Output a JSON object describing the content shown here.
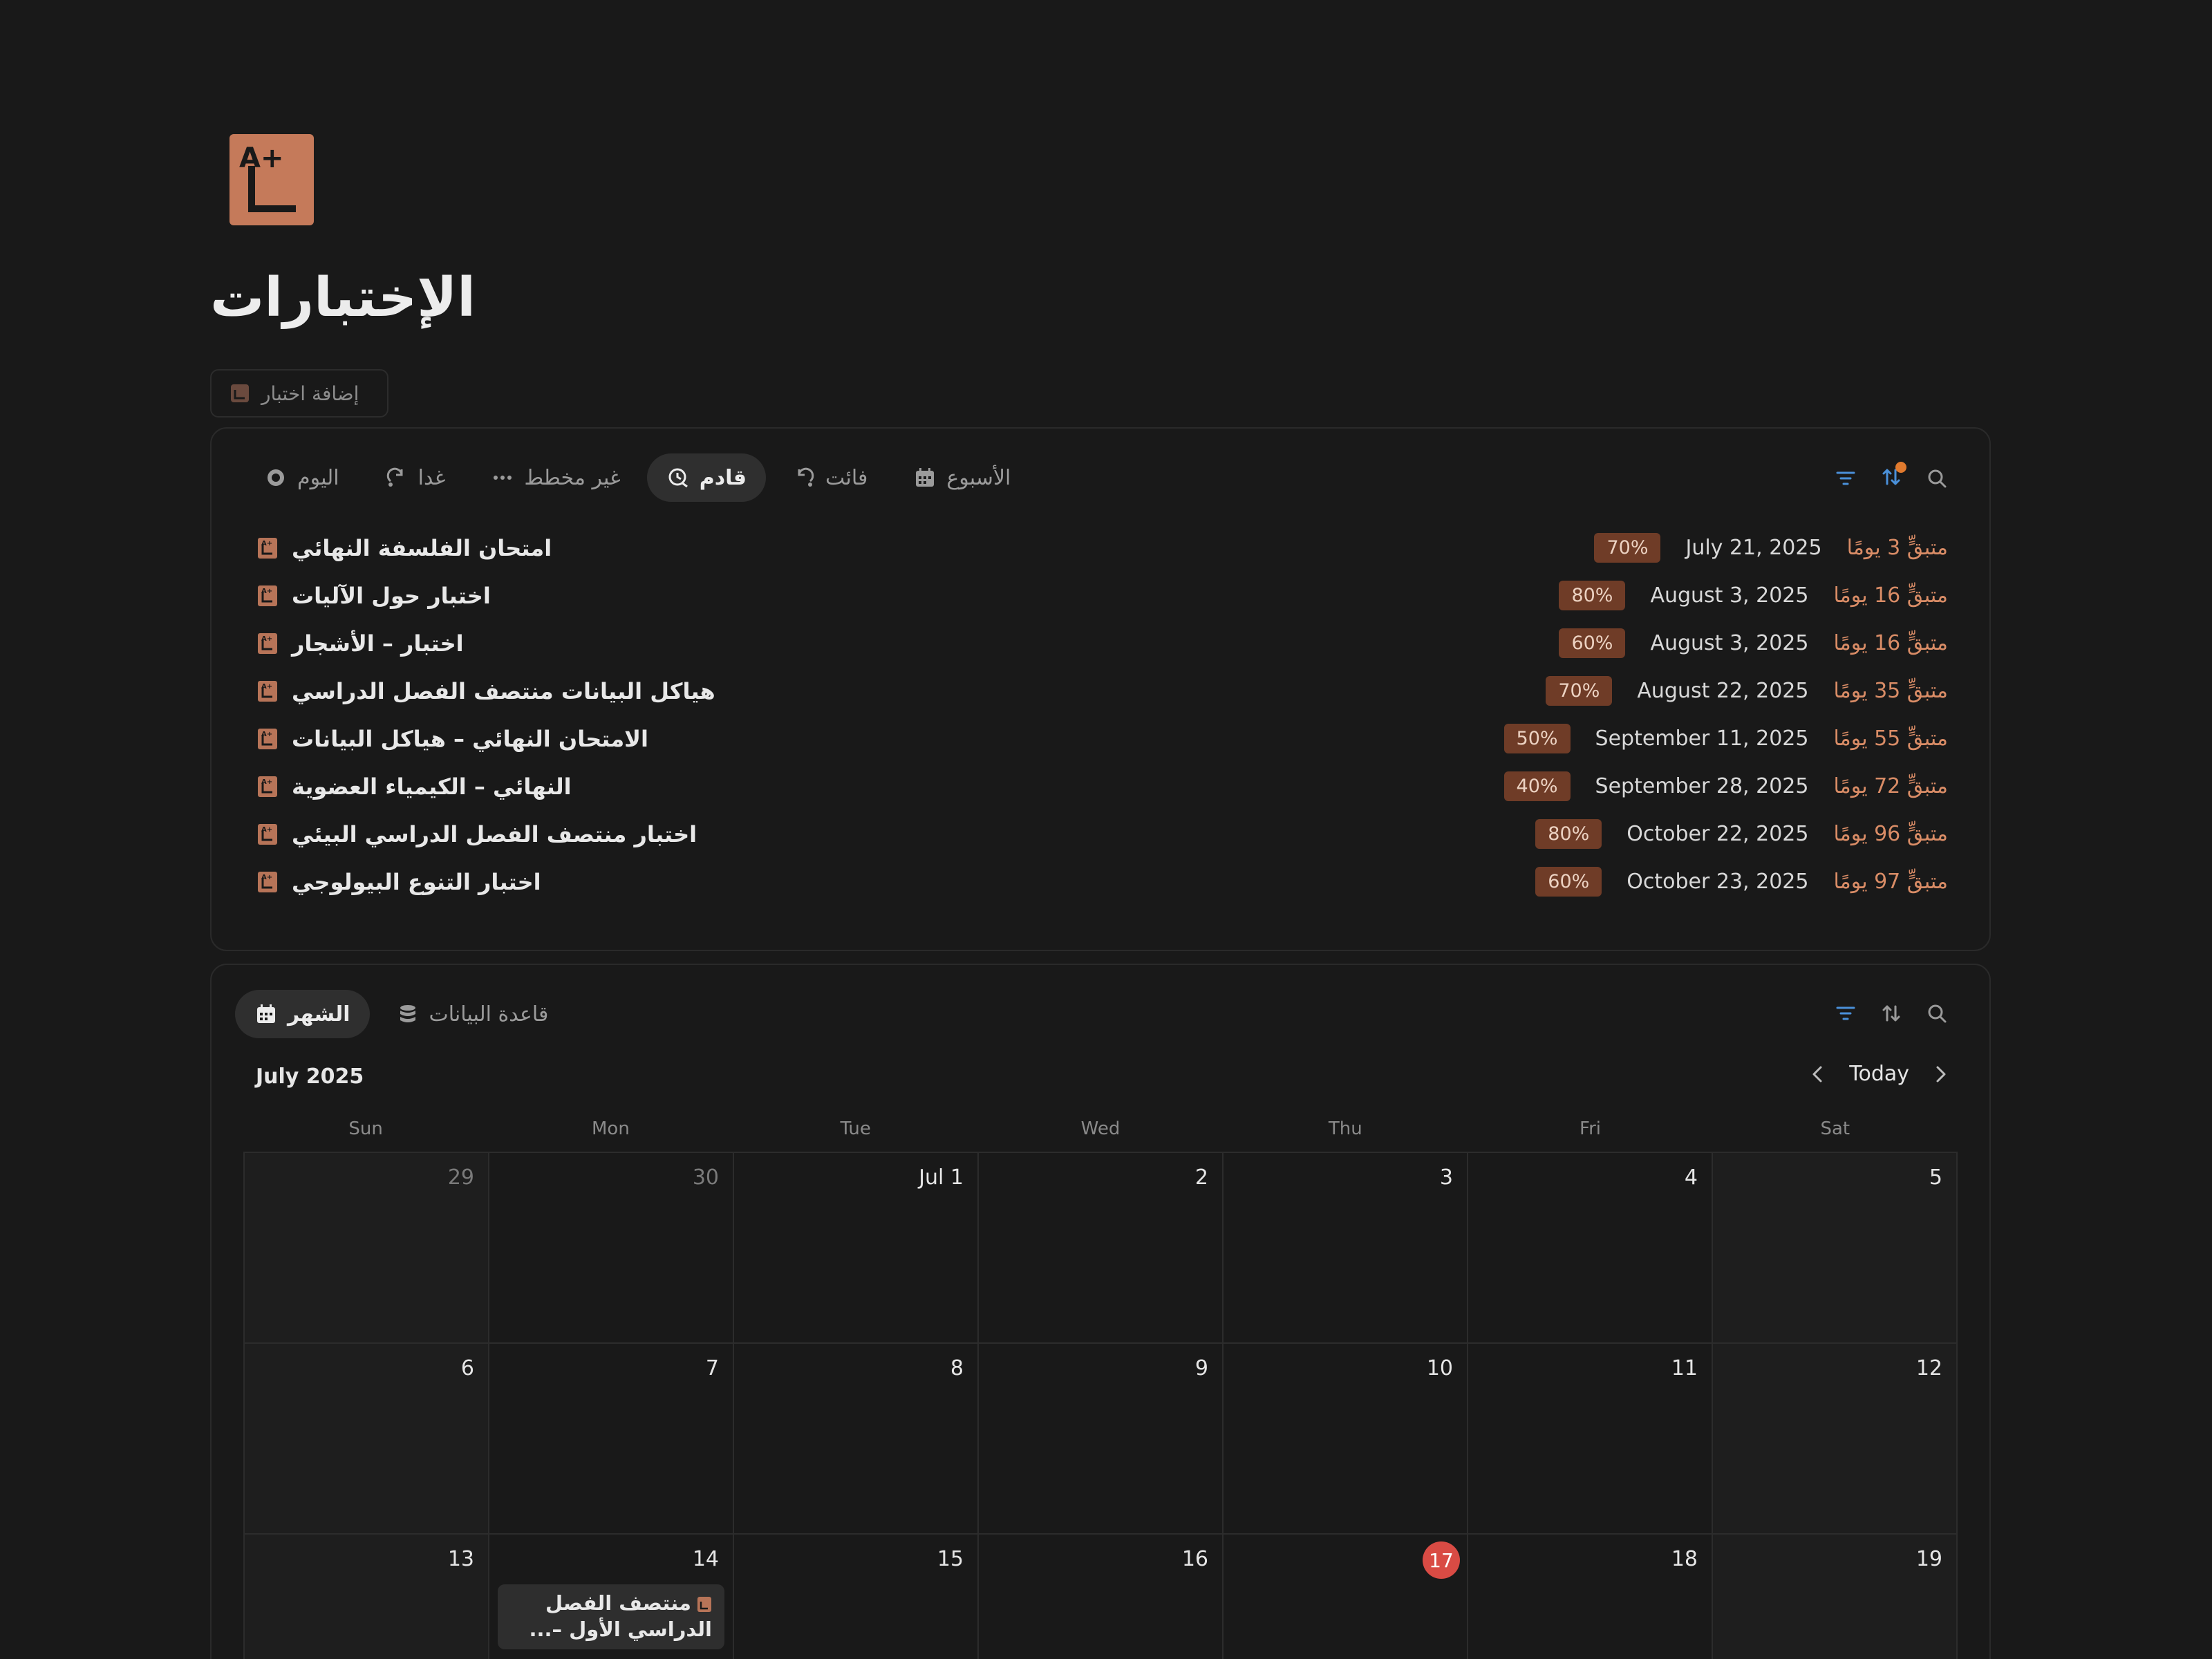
{
  "page": {
    "title": "الإختبارات",
    "add_button": "إضافة اختبار"
  },
  "upcoming": {
    "tabs": [
      {
        "label": "اليوم",
        "icon": "circle-icon",
        "active": false
      },
      {
        "label": "غدا",
        "icon": "redo-icon",
        "active": false
      },
      {
        "label": "غير مخطط",
        "icon": "dots-icon",
        "active": false
      },
      {
        "label": "قادم",
        "icon": "clock-arrow-icon",
        "active": true
      },
      {
        "label": "فائت",
        "icon": "undo-icon",
        "active": false
      },
      {
        "label": "الأسبوع",
        "icon": "calendar-icon",
        "active": false
      }
    ],
    "rows": [
      {
        "name": "امتحان الفلسفة النهائي",
        "pct": "70%",
        "date": "July 21, 2025",
        "remaining": "متبقٍّ 3 يومًا"
      },
      {
        "name": "اختبار حول الآليات",
        "pct": "80%",
        "date": "August 3, 2025",
        "remaining": "متبقٍّ 16 يومًا"
      },
      {
        "name": "اختبار – الأشجار",
        "pct": "60%",
        "date": "August 3, 2025",
        "remaining": "متبقٍّ 16 يومًا"
      },
      {
        "name": "هياكل البيانات منتصف الفصل الدراسي",
        "pct": "70%",
        "date": "August 22, 2025",
        "remaining": "متبقٍّ 35 يومًا"
      },
      {
        "name": "الامتحان النهائي – هياكل البيانات",
        "pct": "50%",
        "date": "September 11, 2025",
        "remaining": "متبقٍّ 55 يومًا"
      },
      {
        "name": "النهائي – الكيمياء العضوية",
        "pct": "40%",
        "date": "September 28, 2025",
        "remaining": "متبقٍّ 72 يومًا"
      },
      {
        "name": "اختبار منتصف الفصل الدراسي البيئي",
        "pct": "80%",
        "date": "October 22, 2025",
        "remaining": "متبقٍّ 96 يومًا"
      },
      {
        "name": "اختبار التنوع البيولوجي",
        "pct": "60%",
        "date": "October 23, 2025",
        "remaining": "متبقٍّ 97 يومًا"
      }
    ]
  },
  "calendar": {
    "tabs": [
      {
        "label": "الشهر",
        "icon": "calendar-icon",
        "active": true
      },
      {
        "label": "قاعدة البيانات",
        "icon": "database-icon",
        "active": false
      }
    ],
    "month_label": "July 2025",
    "today_label": "Today",
    "weekdays": [
      "Sun",
      "Mon",
      "Tue",
      "Wed",
      "Thu",
      "Fri",
      "Sat"
    ],
    "cells": [
      {
        "label": "29",
        "muted": true
      },
      {
        "label": "30",
        "muted": true
      },
      {
        "label": "Jul 1"
      },
      {
        "label": "2"
      },
      {
        "label": "3"
      },
      {
        "label": "4"
      },
      {
        "label": "5"
      },
      {
        "label": "6"
      },
      {
        "label": "7"
      },
      {
        "label": "8"
      },
      {
        "label": "9"
      },
      {
        "label": "10"
      },
      {
        "label": "11"
      },
      {
        "label": "12"
      },
      {
        "label": "13"
      },
      {
        "label": "14",
        "event": "منتصف الفصل الدراسي الأول –..."
      },
      {
        "label": "15"
      },
      {
        "label": "16"
      },
      {
        "label": "17",
        "today": true
      },
      {
        "label": "18"
      },
      {
        "label": "19"
      }
    ]
  },
  "colors": {
    "background": "#191919",
    "accent_pct": "#6f3c27",
    "remaining_text": "#d98c66",
    "today_circle": "#d94b44",
    "toolbar_icon": "#4a90d9"
  }
}
